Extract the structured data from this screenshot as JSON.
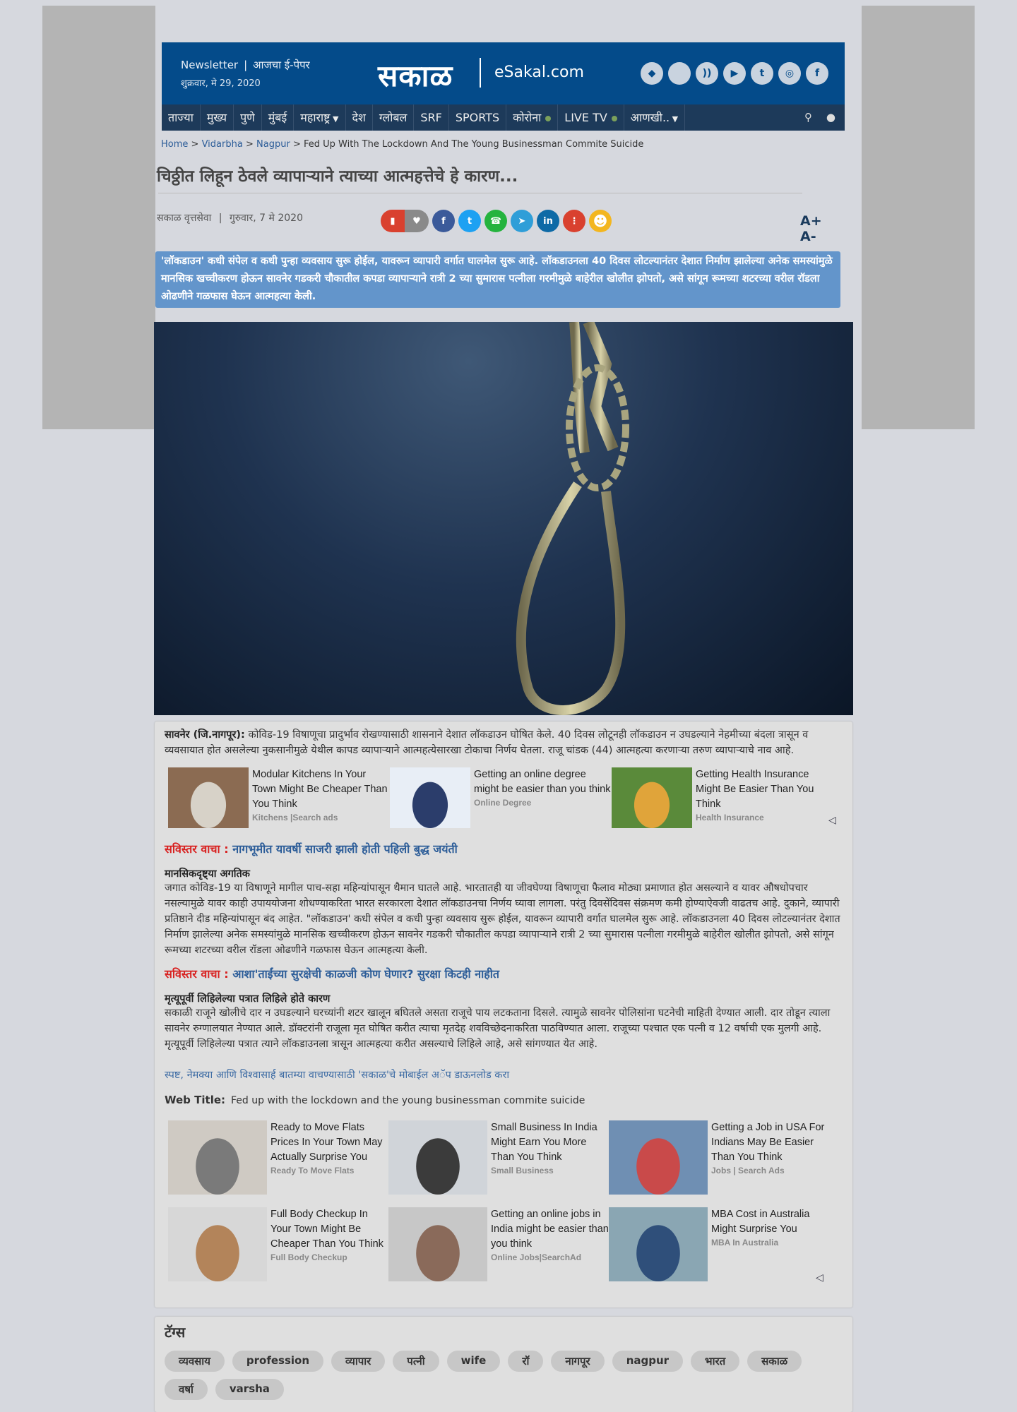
{
  "header": {
    "newsletter": "Newsletter",
    "separator": "|",
    "epaper": "आजचा ई-पेपर",
    "date": "शुक्रवार, मे 29, 2020",
    "logo": "सकाळ",
    "esakal": "eSakal.com",
    "social": [
      {
        "icon": "android-icon",
        "glyph": "◆"
      },
      {
        "icon": "apple-icon",
        "glyph": ""
      },
      {
        "icon": "rss-icon",
        "glyph": "))"
      },
      {
        "icon": "youtube-icon",
        "glyph": "▶"
      },
      {
        "icon": "twitter-icon",
        "glyph": "t"
      },
      {
        "icon": "instagram-icon",
        "glyph": "◎"
      },
      {
        "icon": "facebook-icon",
        "glyph": "f"
      }
    ]
  },
  "nav": {
    "items": [
      "ताज्या",
      "मुख्य",
      "पुणे",
      "मुंबई",
      "महाराष्ट्र",
      "देश",
      "ग्लोबल",
      "SRF",
      "SPORTS",
      "कोरोना",
      "LIVE TV",
      "आणखी.."
    ],
    "search_icon": "search-icon",
    "mic_icon": "microphone-icon"
  },
  "breadcrumb": {
    "home": "Home",
    "sep": ">",
    "vidarbha": "Vidarbha",
    "nagpur": "Nagpur",
    "current": "Fed Up With The Lockdown And The Young Businessman Commite Suicide"
  },
  "article": {
    "title": "चिठ्ठीत लिहून ठेवले व्यापाऱ्याने त्याच्या आत्महत्तेचे हे कारण...",
    "source": "सकाळ वृत्तसेवा",
    "date": "गुरुवार, 7 मे 2020",
    "font_increase": "A+",
    "font_decrease": "A-",
    "summary": "'लॉकडाउन' कधी संपेल व कधी पुन्हा व्यवसाय सुरू होईल, यावरून व्यापारी वर्गात घालमेल सुरू आहे. लॉकडाउनला 40 दिवस लोटल्यानंतर देशात निर्माण झालेल्या अनेक समस्यांमुळे मानसिक खच्चीकरण होऊन सावनेर गडकरी चौकातील कपडा व्यापाऱ्याने रात्री 2 च्या सुमारास पत्नीला गरमीमुळे बाहेरील खोलीत झोपतो, असे सांगून रूमच्या शटरच्या वरील रॉडला ओढणीने गळफास घेऊन आत्महत्या केली.",
    "dateline": "सावनेर (जि.नागपूर):",
    "para1": "कोविड-19 विषाणूचा प्रादुर्भाव रोखण्यासाठी शासनाने देशात लॉकडाउन घोषित केले. 40 दिवस लोटूनही लॉकडाउन न उघडल्याने नेहमीच्या बंदला त्रासून व व्यवसायात होत असलेल्या नुकसानीमुळे येथील कापड व्यापाऱ्याने आत्महत्येसारखा टोकाचा निर्णय घेतला. राजू चांडक (44) आत्महत्या करणाऱ्या तरुण व्यापाऱ्याचे नाव आहे.",
    "read_more_label": "सविस्तर वाचा :",
    "read_more_1": "नागभूमीत यावर्षी साजरी झाली होती पहिली बुद्ध जयंती",
    "subhead_1": "मानसिकदृष्ट्या अगतिक",
    "para2": "जगात कोविड-19 या विषाणूने मागील पाच-सहा महिन्यांपासून थैमान घातले आहे. भारतातही या जीवघेण्या विषाणूचा फैलाव मोठ्या प्रमाणात होत असल्याने व यावर औषधोपचार नसल्यामुळे यावर काही उपाययोजना शोधण्याकरिता भारत सरकारला देशात लॉकडाउनचा निर्णय घ्यावा लागला. परंतु दिवसेंदिवस संक्रमण कमी होण्याऐवजी वाढतच आहे. दुकाने, व्यापारी प्रतिष्ठाने दीड महिन्यांपासून बंद आहेत. \"लॉकडाउन' कधी संपेल व कधी पुन्हा व्यवसाय सुरू होईल, यावरून व्यापारी वर्गात घालमेल सुरू आहे. लॉकडाउनला 40 दिवस लोटल्यानंतर देशात निर्माण झालेल्या अनेक समस्यांमुळे मानसिक खच्चीकरण होऊन सावनेर गडकरी चौकातील कपडा व्यापाऱ्याने रात्री 2 च्या सुमारास पत्नीला गरमीमुळे बाहेरील खोलीत झोपतो, असे सांगून रूमच्या शटरच्या वरील रॉडला ओढणीने गळफास घेऊन आत्महत्या केली.",
    "read_more_2": "आशा'ताईंच्या सुरक्षेची काळजी कोण घेणार? सुरक्षा किटही नाहीत",
    "subhead_2": "मृत्यूपूर्वी लिहिलेल्या पत्रात लिहिले होते कारण",
    "para3": "सकाळी राजूने खोलीचे दार न उघडल्याने घरच्यांनी शटर खालून बघितले असता राजूचे पाय लटकताना दिसले. त्यामुळे सावनेर पोलिसांना घटनेची माहिती देण्यात आली. दार तोडून त्याला सावनेर रुग्णालयात नेण्यात आले. डॉक्टरांनी राजूला मृत घोषित करीत त्याचा मृतदेह शवविच्छेदनाकरिता पाठविण्यात आला. राजूच्या पश्चात एक पत्नी व 12 वर्षाची एक मुलगी आहे. मृत्यूपूर्वी लिहिलेल्या पत्रात त्याने लॉकडाउनला त्रासून आत्महत्या करीत असल्याचे लिहिले आहे, असे सांगण्यात येत आहे.",
    "app_line": "स्पष्ट, नेमक्या आणि विश्वासार्ह बातम्या वाचण्यासाठी 'सकाळ'चे मोबाईल अॅप डाऊनलोड करा",
    "web_title_label": "Web Title:",
    "web_title": "Fed up with the lockdown and the young businessman commite suicide"
  },
  "sponsored_top": [
    {
      "title": "Modular Kitchens In Your Town Might Be Cheaper Than You Think",
      "source": "Kitchens |Search ads"
    },
    {
      "title": "Getting an online degree might be easier than you think",
      "source": "Online Degree"
    },
    {
      "title": "Getting Health Insurance Might Be Easier Than You Think",
      "source": "Health Insurance"
    }
  ],
  "sponsored_bottom": [
    {
      "title": "Ready to Move Flats Prices In Your Town May Actually Surprise You",
      "source": "Ready To Move Flats"
    },
    {
      "title": "Small Business In India Might Earn You More Than You Think",
      "source": "Small Business"
    },
    {
      "title": "Getting a Job in USA For Indians May Be Easier Than You Think",
      "source": "Jobs | Search Ads"
    },
    {
      "title": "Full Body Checkup In Your Town Might Be Cheaper Than You Think",
      "source": "Full Body Checkup"
    },
    {
      "title": "Getting an online jobs in India might be easier than you think",
      "source": "Online Jobs|SearchAd"
    },
    {
      "title": "MBA Cost in Australia Might Surprise You",
      "source": "MBA In Australia"
    }
  ],
  "tags": {
    "heading": "टॅग्स",
    "items": [
      "व्यवसाय",
      "profession",
      "व्यापार",
      "पत्नी",
      "wife",
      "रॉ",
      "नागपूर",
      "nagpur",
      "भारत",
      "सकाळ",
      "वर्षा",
      "varsha"
    ]
  },
  "colors": {
    "brand_blue": "#044b8a",
    "nav_bg": "#1d3a5a",
    "summary_bg": "#6395cb",
    "read_more_red": "#d8201f",
    "link_blue": "#2b5c98"
  }
}
